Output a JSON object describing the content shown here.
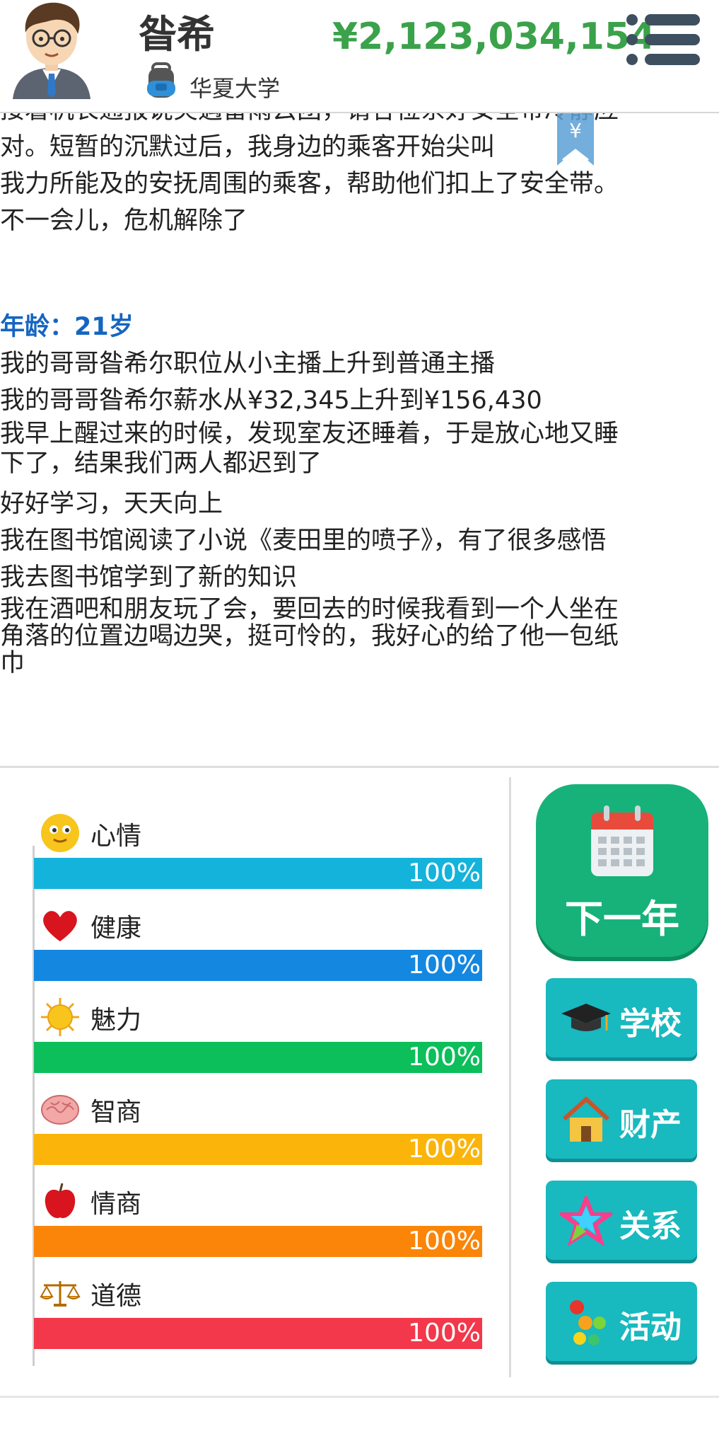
{
  "header": {
    "name": "昝希",
    "school": "华夏大学",
    "money": "¥2,123,034,154"
  },
  "log": {
    "lines_top": [
      "接着机长通报说突遇雷雨云团，请各位系好安全带冷静应",
      "对。短暂的沉默过后，我身边的乘客开始尖叫",
      "我力所能及的安抚周围的乘客，帮助他们扣上了安全带。",
      "不一会儿，危机解除了"
    ],
    "age": "年龄：21岁",
    "lines": [
      "我的哥哥昝希尔职位从小主播上升到普通主播",
      "我的哥哥昝希尔薪水从¥32,345上升到¥156,430",
      "我早上醒过来的时候，发现室友还睡着，于是放心地又睡",
      "下了，结果我们两人都迟到了",
      "好好学习，天天向上",
      "我在图书馆阅读了小说《麦田里的喷子》，有了很多感悟",
      "我去图书馆学到了新的知识",
      "我在酒吧和朋友玩了会，要回去的时候我看到一个人坐在",
      "角落的位置边喝边哭，挺可怜的，我好心的给了他一包纸",
      "巾"
    ],
    "coin_symbol": "¥"
  },
  "stats": [
    {
      "label": "心情",
      "value": "100%",
      "fraction": 1.0,
      "color": "#14b3dc",
      "icon": "smiley-icon"
    },
    {
      "label": "健康",
      "value": "100%",
      "fraction": 1.0,
      "color": "#1487e0",
      "icon": "heart-icon"
    },
    {
      "label": "魅力",
      "value": "100%",
      "fraction": 1.0,
      "color": "#0cbf5a",
      "icon": "sun-icon"
    },
    {
      "label": "智商",
      "value": "100%",
      "fraction": 1.0,
      "color": "#fbb40a",
      "icon": "brain-icon"
    },
    {
      "label": "情商",
      "value": "100%",
      "fraction": 1.0,
      "color": "#fb8508",
      "icon": "apple-icon"
    },
    {
      "label": "道德",
      "value": "100%",
      "fraction": 1.0,
      "color": "#f2384a",
      "icon": "scales-icon"
    }
  ],
  "actions": {
    "next_year": "下一年",
    "school": "学校",
    "property": "财产",
    "relations": "关系",
    "activities": "活动"
  }
}
